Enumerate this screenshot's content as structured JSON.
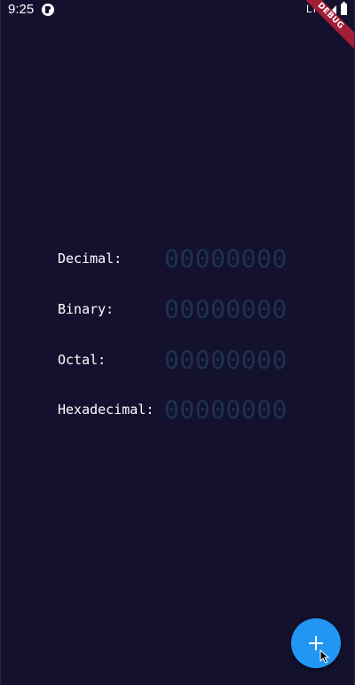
{
  "status_bar": {
    "time": "9:25",
    "network": "LTE",
    "app_icon": "flutter-app-icon",
    "signal_icon": "cell-signal-icon",
    "battery_icon": "battery-icon"
  },
  "debug_banner": {
    "label": "DEBUG",
    "color": "#a41d36"
  },
  "converter": {
    "rows": [
      {
        "label": "Decimal:",
        "value": "00000000"
      },
      {
        "label": "Binary:",
        "value": "00000000"
      },
      {
        "label": "Octal:",
        "value": "00000000"
      },
      {
        "label": "Hexadecimal:",
        "value": "00000000"
      }
    ]
  },
  "fab": {
    "icon": "plus-icon",
    "color": "#2196f3"
  },
  "colors": {
    "background": "#14112e",
    "value_text": "#1c3350",
    "label_text": "#ffffff"
  }
}
